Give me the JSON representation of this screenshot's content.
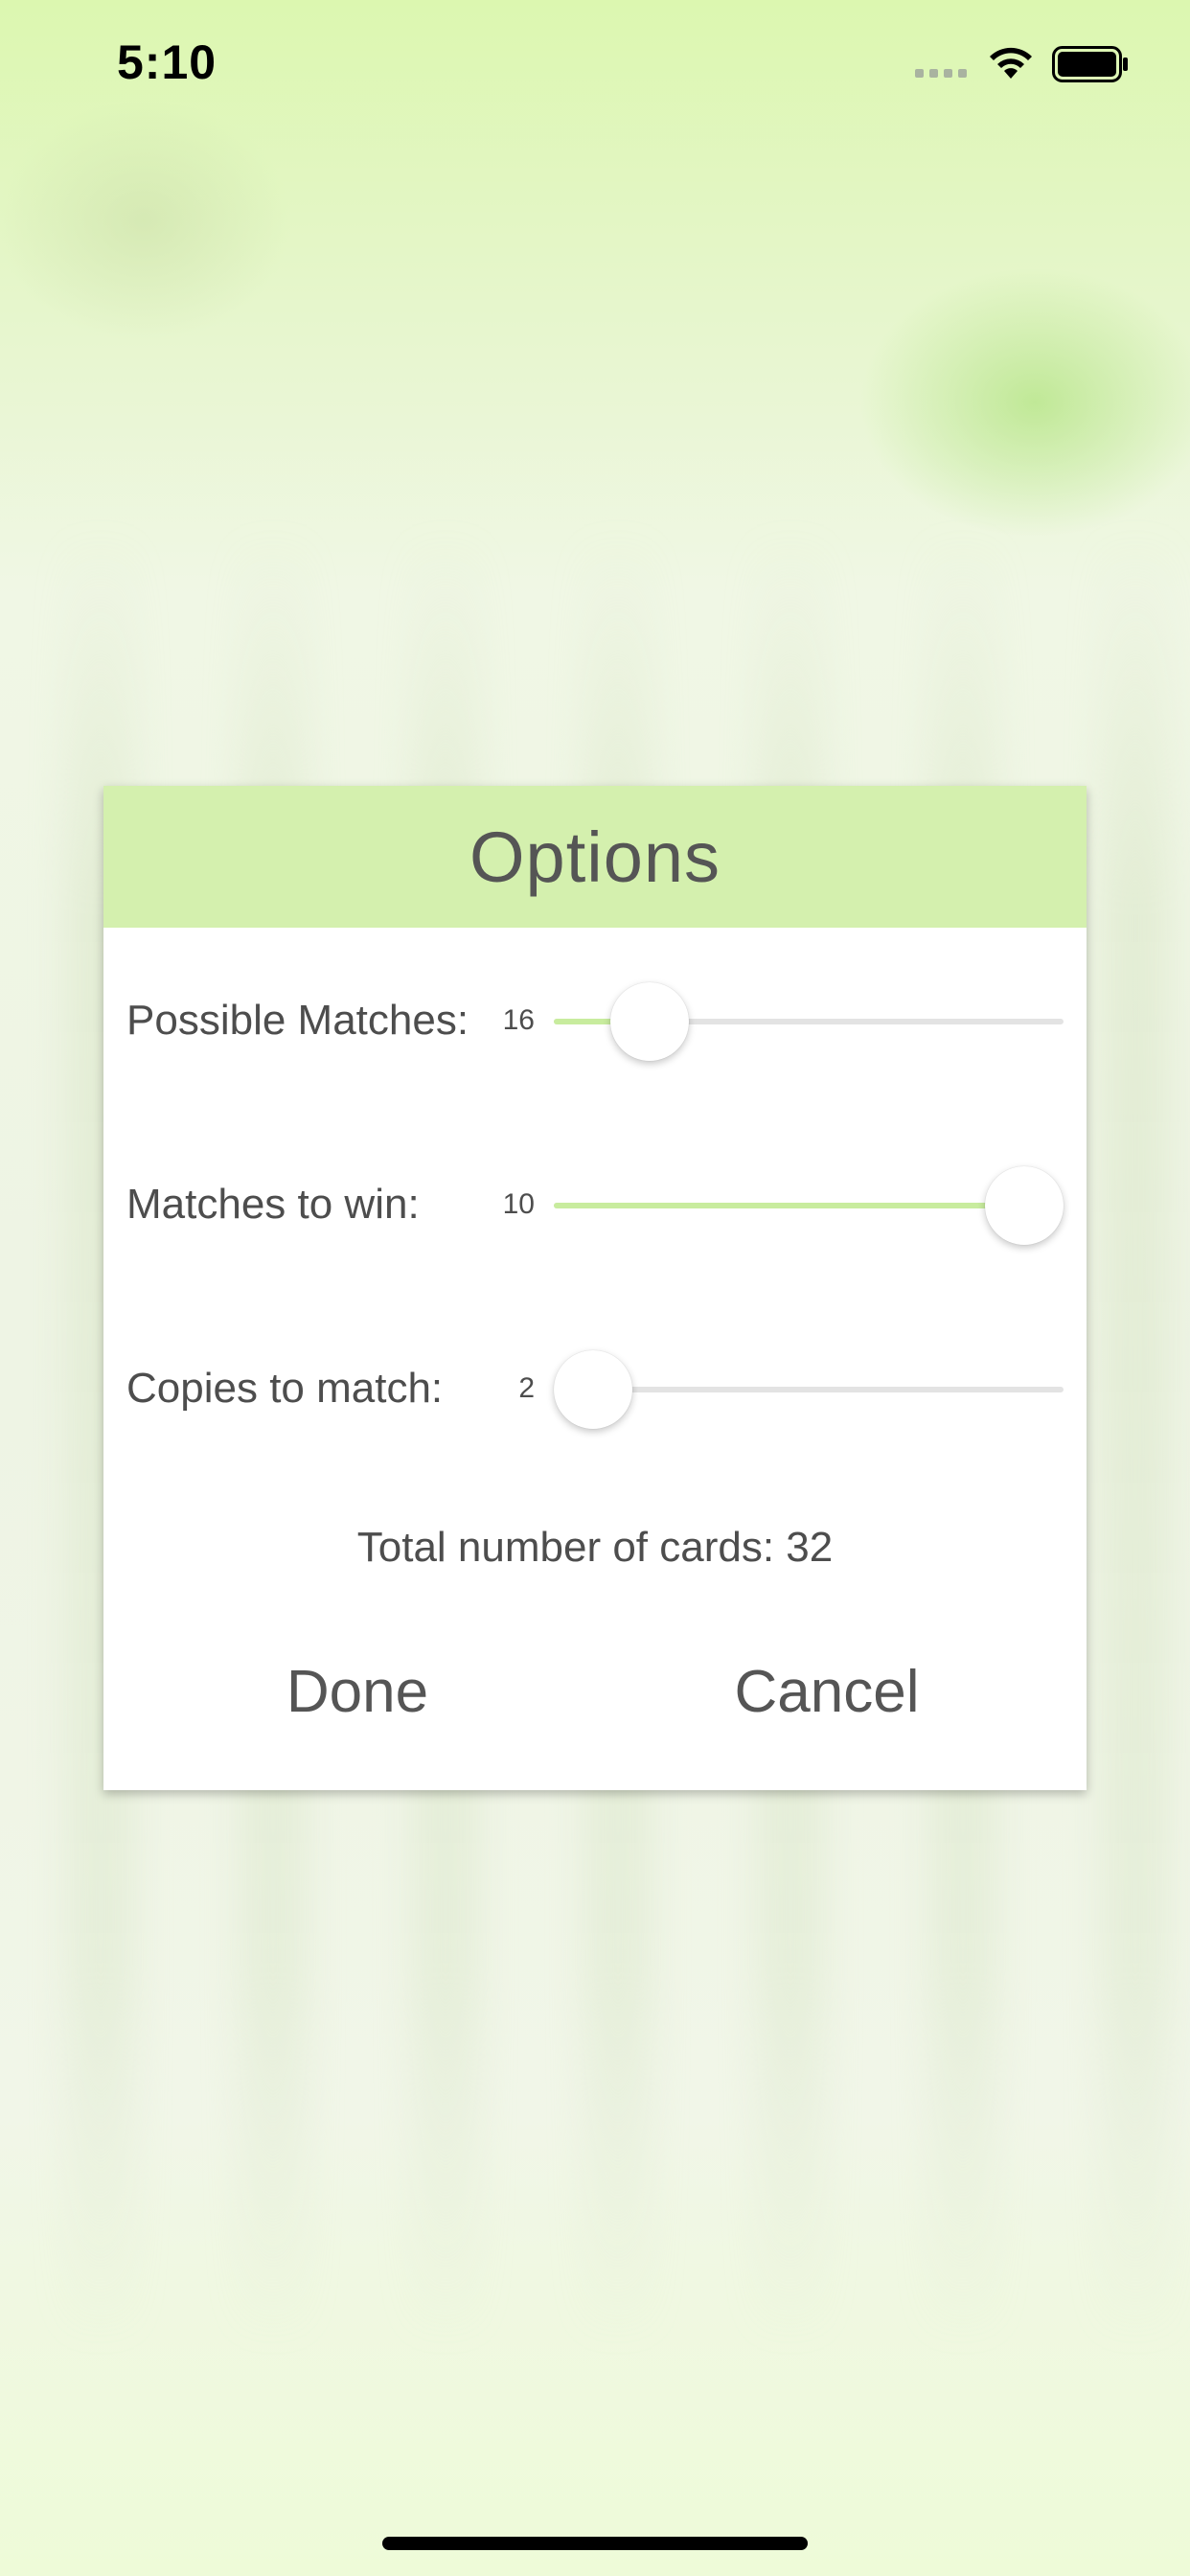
{
  "status_bar": {
    "time": "5:10",
    "signal_icon": "signal-dots-icon",
    "wifi_icon": "wifi-icon",
    "battery_icon": "battery-icon"
  },
  "dialog": {
    "title": "Options",
    "header_color": "#d4f0ae",
    "accent_color": "#c8ec9e",
    "rows": [
      {
        "label": "Possible Matches:",
        "value": "16",
        "slider_fraction": 0.13
      },
      {
        "label": "Matches to win:",
        "value": "10",
        "slider_fraction": 1.0
      },
      {
        "label": "Copies to match:",
        "value": "2",
        "slider_fraction": 0.0
      }
    ],
    "total_label": "Total number of cards: 32",
    "done_label": "Done",
    "cancel_label": "Cancel"
  }
}
